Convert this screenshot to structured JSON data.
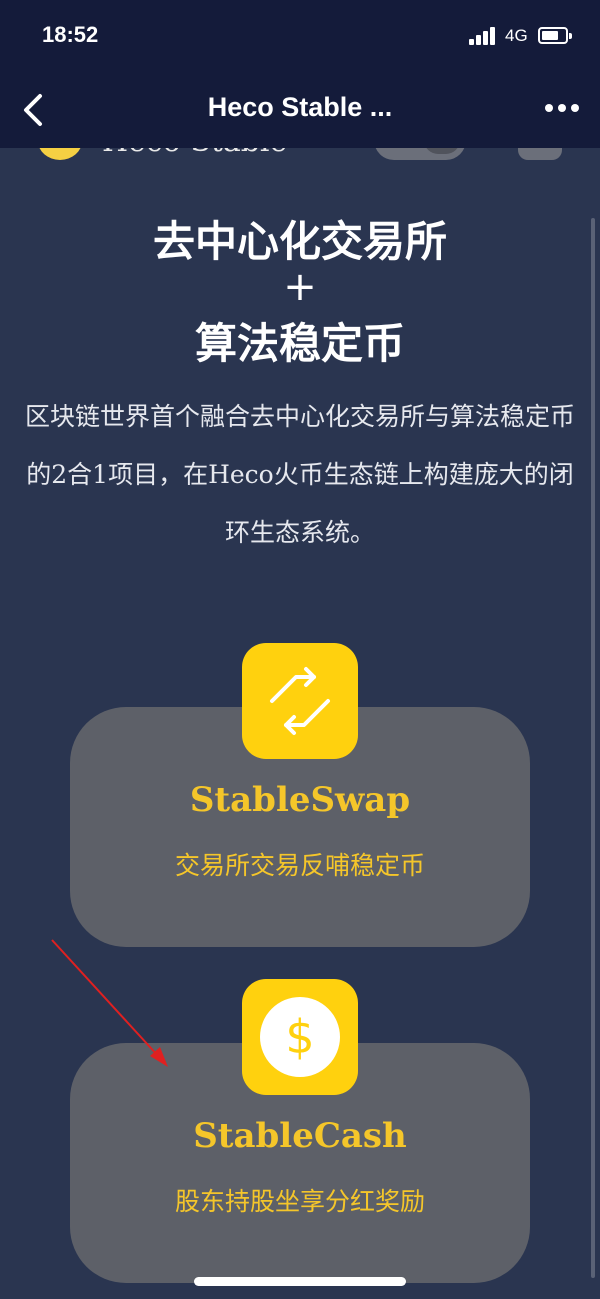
{
  "status_bar": {
    "time": "18:52",
    "network": "4G"
  },
  "nav": {
    "title": "Heco Stable ...",
    "back_icon": "chevron-left-icon",
    "more_icon": "more-dots-icon"
  },
  "header_peek": {
    "brand_text": "Heco Stable"
  },
  "hero": {
    "line1": "去中心化交易所",
    "plus": "+",
    "line2": "算法稳定币",
    "description": "区块链世界首个融合去中心化交易所与算法稳定币的2合1项目，在Heco火币生态链上构建庞大的闭环生态系统。"
  },
  "cards": [
    {
      "title": "StableSwap",
      "subtitle": "交易所交易反哺稳定币",
      "icon": "swap-arrows-icon"
    },
    {
      "title": "StableCash",
      "subtitle": "股东持股坐享分红奖励",
      "icon": "dollar-coin-icon"
    }
  ],
  "colors": {
    "background": "#2a3550",
    "topbar": "#141b3a",
    "accent": "#ffd10e",
    "card": "#5d6068",
    "annotation_arrow": "#e02020"
  }
}
